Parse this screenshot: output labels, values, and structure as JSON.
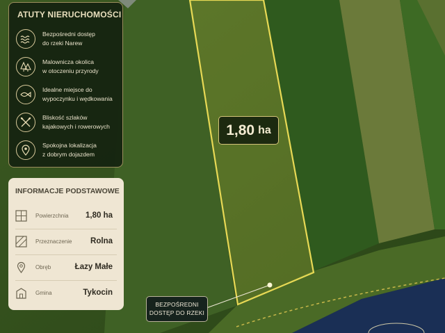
{
  "amenities": {
    "title": "ATUTY NIERUCHOMOŚCI",
    "items": [
      {
        "icon": "waves-icon",
        "line1": "Bezpośredni dostęp",
        "line2": "do rzeki Narew"
      },
      {
        "icon": "trees-icon",
        "line1": "Malownicza okolica",
        "line2": "w otoczeniu przyrody"
      },
      {
        "icon": "fishing-icon",
        "line1": "Idealne miejsce do",
        "line2": "wypoczynku i wędkowania"
      },
      {
        "icon": "paddles-icon",
        "line1": "Bliskość szlaków",
        "line2": "kajakowych i rowerowych"
      },
      {
        "icon": "location-pin-icon",
        "line1": "Spokojna lokalizacja",
        "line2": "z dobrym dojazdem"
      }
    ]
  },
  "basic_info": {
    "title": "INFORMACJE PODSTAWOWE",
    "rows": [
      {
        "icon": "area-grid-icon",
        "label": "Powierzchnia",
        "value": "1,80 ha"
      },
      {
        "icon": "land-use-icon",
        "label": "Przeznaczenie",
        "value": "Rolna"
      },
      {
        "icon": "map-pin-icon",
        "label": "Obręb",
        "value": "Łazy Małe"
      },
      {
        "icon": "building-icon",
        "label": "Gmina",
        "value": "Tykocin"
      }
    ]
  },
  "map": {
    "area_value": "1,80",
    "area_unit": "ha",
    "river_label_line1": "BEZPOŚREDNI",
    "river_label_line2": "DOSTĘP DO RZEKI"
  },
  "colors": {
    "accent": "#e3d25a",
    "panel_dark": "#142210",
    "panel_light": "#efe6d3",
    "river": "#1a2f55"
  }
}
